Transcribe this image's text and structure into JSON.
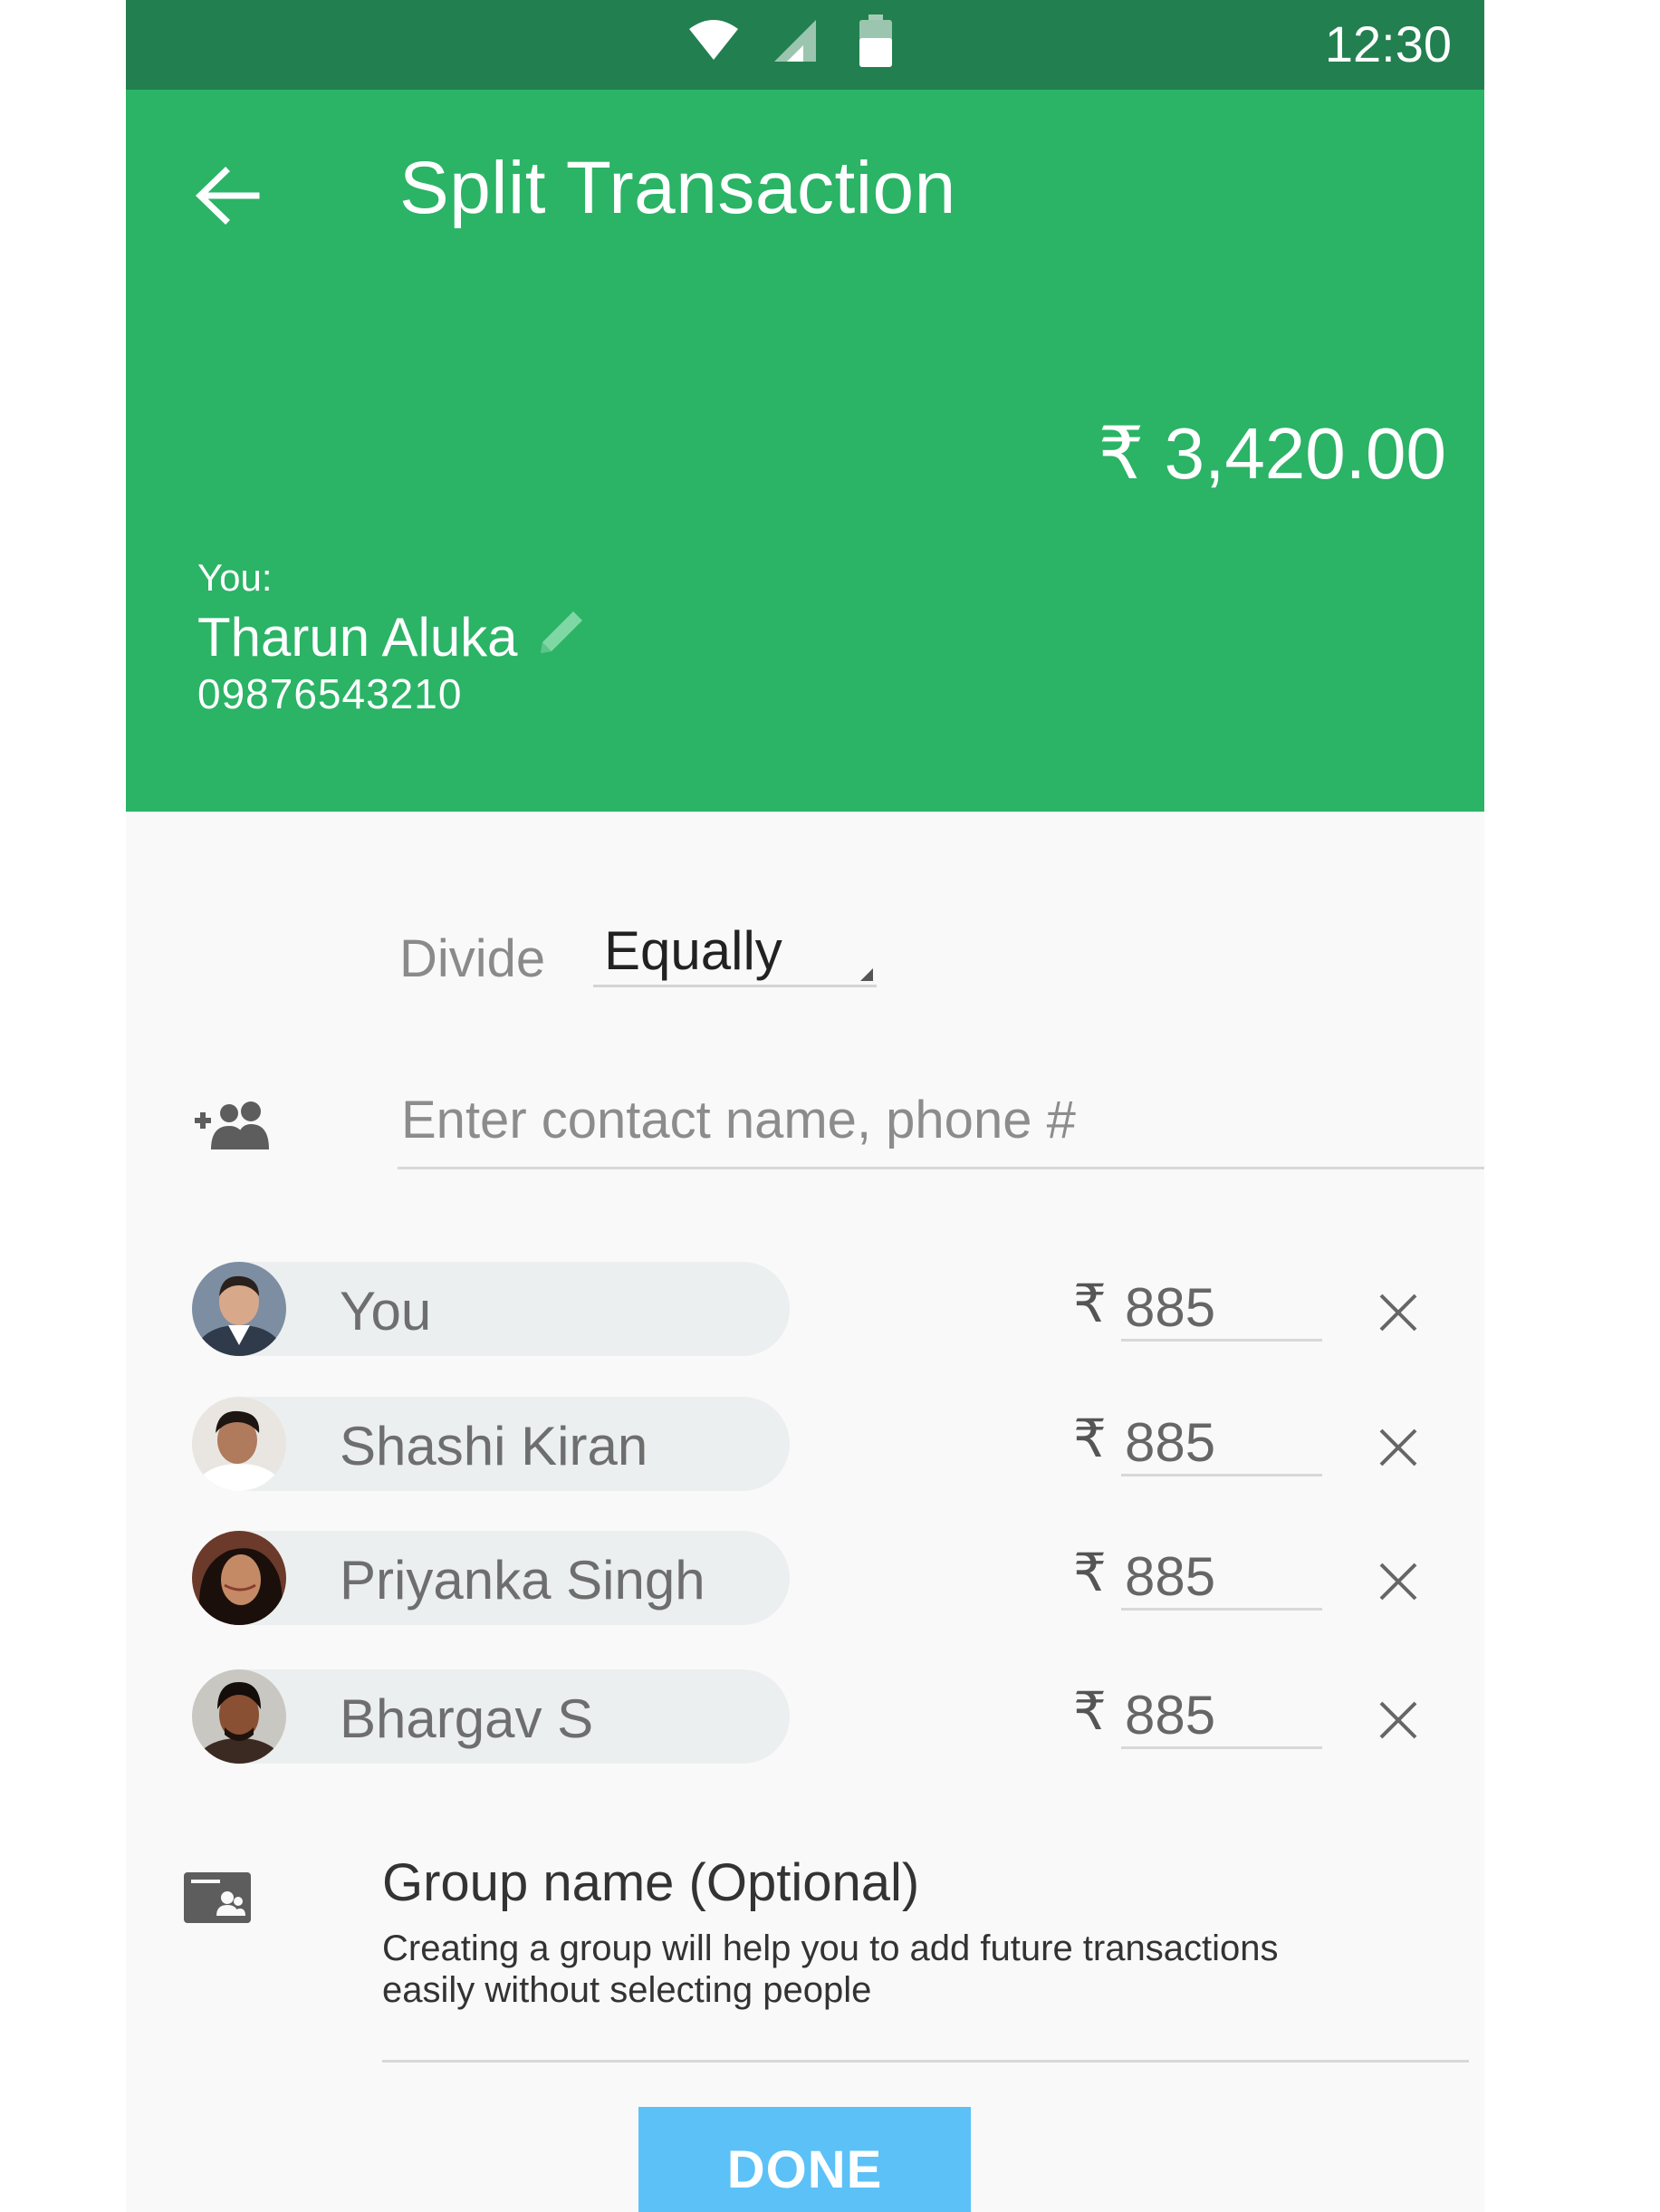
{
  "status_bar": {
    "time": "12:30"
  },
  "app_bar": {
    "title": "Split Transaction",
    "total_amount": "₹ 3,420.00",
    "you_label": "You:",
    "user_name": "Tharun Aluka",
    "user_phone": "09876543210"
  },
  "divide": {
    "label": "Divide",
    "selected": "Equally"
  },
  "contact_search": {
    "placeholder": "Enter contact name, phone #"
  },
  "participants": [
    {
      "name": "You",
      "currency": "₹",
      "amount": "885"
    },
    {
      "name": "Shashi Kiran",
      "currency": "₹",
      "amount": "885"
    },
    {
      "name": "Priyanka Singh",
      "currency": "₹",
      "amount": "885"
    },
    {
      "name": "Bhargav S",
      "currency": "₹",
      "amount": "885"
    }
  ],
  "group": {
    "title": "Group name (Optional)",
    "help_text": "Creating a group will help you to add future transactions easily without selecting people"
  },
  "done_label": "DONE",
  "colors": {
    "status_bar": "#227f4f",
    "app_bar": "#2bb366",
    "done_button": "#5cc1f7",
    "background": "#f9f9f9"
  }
}
